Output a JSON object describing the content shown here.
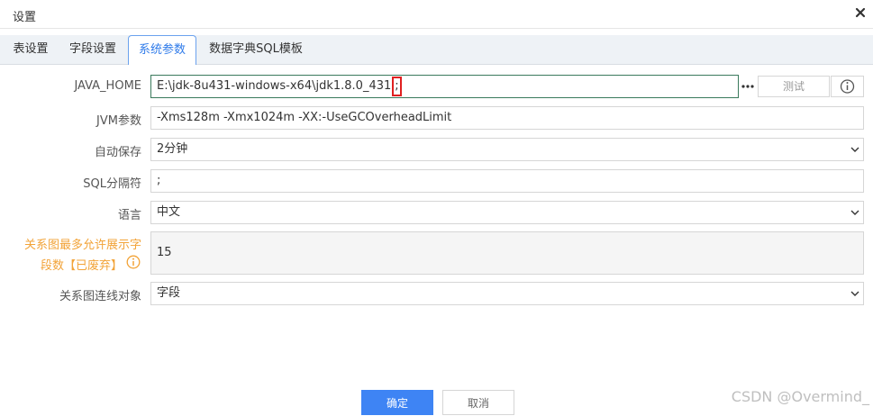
{
  "window": {
    "title": "设置"
  },
  "tabs": [
    {
      "label": "表设置"
    },
    {
      "label": "字段设置"
    },
    {
      "label": "系统参数"
    },
    {
      "label": "数据字典SQL模板"
    }
  ],
  "form": {
    "java_home": {
      "label": "JAVA_HOME",
      "value": "E:\\jdk-8u431-windows-x64\\jdk1.8.0_431",
      "cursor_char": ";",
      "test_label": "测试"
    },
    "jvm": {
      "label": "JVM参数",
      "value": "-Xms128m -Xmx1024m -XX:-UseGCOverheadLimit"
    },
    "autosave": {
      "label": "自动保存",
      "value": "2分钟"
    },
    "sql_sep": {
      "label": "SQL分隔符",
      "value": ";"
    },
    "language": {
      "label": "语言",
      "value": "中文"
    },
    "max_fields": {
      "label_line1": "关系图最多允许展示字",
      "label_line2": "段数【已废弃】",
      "value": "15"
    },
    "link_target": {
      "label": "关系图连线对象",
      "value": "字段"
    }
  },
  "footer": {
    "confirm_label": "确定",
    "cancel_label": "取消",
    "watermark": "CSDN @Overmind_"
  },
  "colors": {
    "accent": "#3e84f4",
    "warning": "#f2a338",
    "highlight": "#e02020"
  }
}
